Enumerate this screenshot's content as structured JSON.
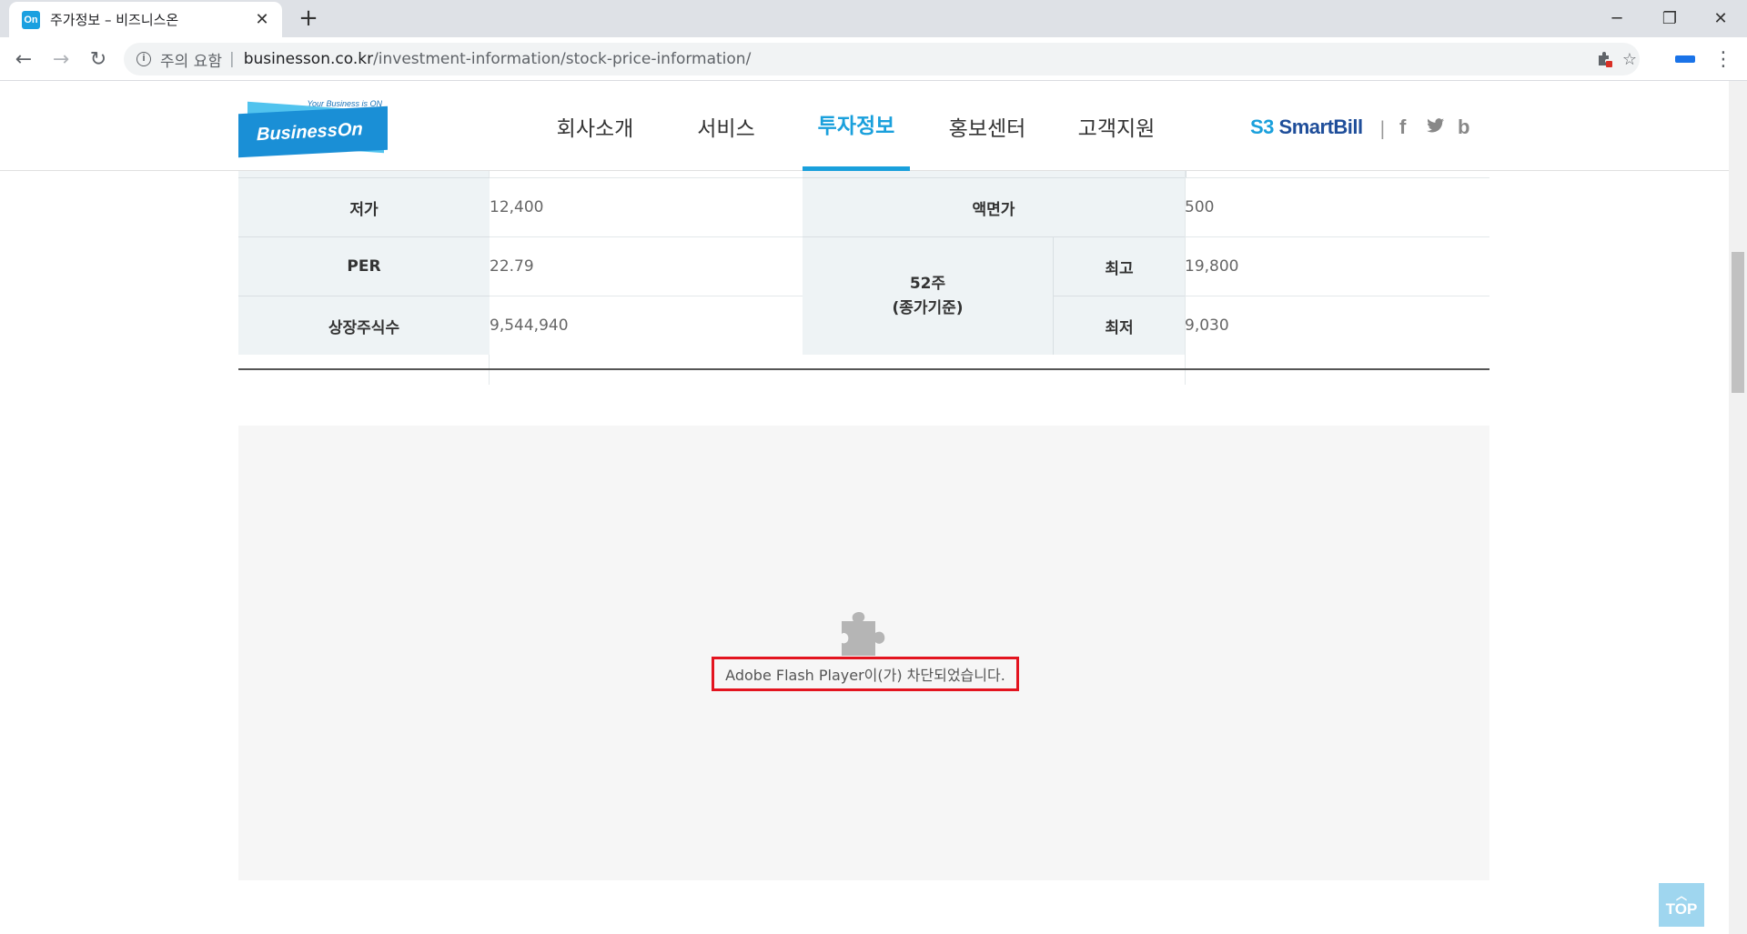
{
  "browser": {
    "tab_title": "주가정보 – 비즈니스온",
    "favicon_text": "On",
    "new_tab": "+",
    "security_label": "주의 요함",
    "separator": "|",
    "url_host": "businesson.co.kr",
    "url_path": "/investment-information/stock-price-information/"
  },
  "site": {
    "logo_tagline": "Your Business is ON",
    "logo_text": "BusinessOn",
    "nav": [
      {
        "label": "회사소개"
      },
      {
        "label": "서비스"
      },
      {
        "label": "투자정보"
      },
      {
        "label": "홍보센터"
      },
      {
        "label": "고객지원"
      }
    ],
    "active_nav": "투자정보",
    "smartbill": "SmartBill",
    "social": {
      "facebook": "f",
      "twitter": "t",
      "blog": "b"
    },
    "accent_color": "#1aa0dc"
  },
  "stock_table": {
    "low_label": "저가",
    "low_value": "12,400",
    "par_label": "액면가",
    "par_value": "500",
    "per_label": "PER",
    "per_value": "22.79",
    "shares_label": "상장주식수",
    "shares_value": "9,544,940",
    "week52_label_line1": "52주",
    "week52_label_line2": "(종가기준)",
    "high_label": "최고",
    "high_value": "19,800",
    "min_label": "최저",
    "min_value": "9,030"
  },
  "flash": {
    "message": "Adobe Flash Player이(가) 차단되었습니다."
  },
  "top_button": {
    "label": "TOP"
  }
}
